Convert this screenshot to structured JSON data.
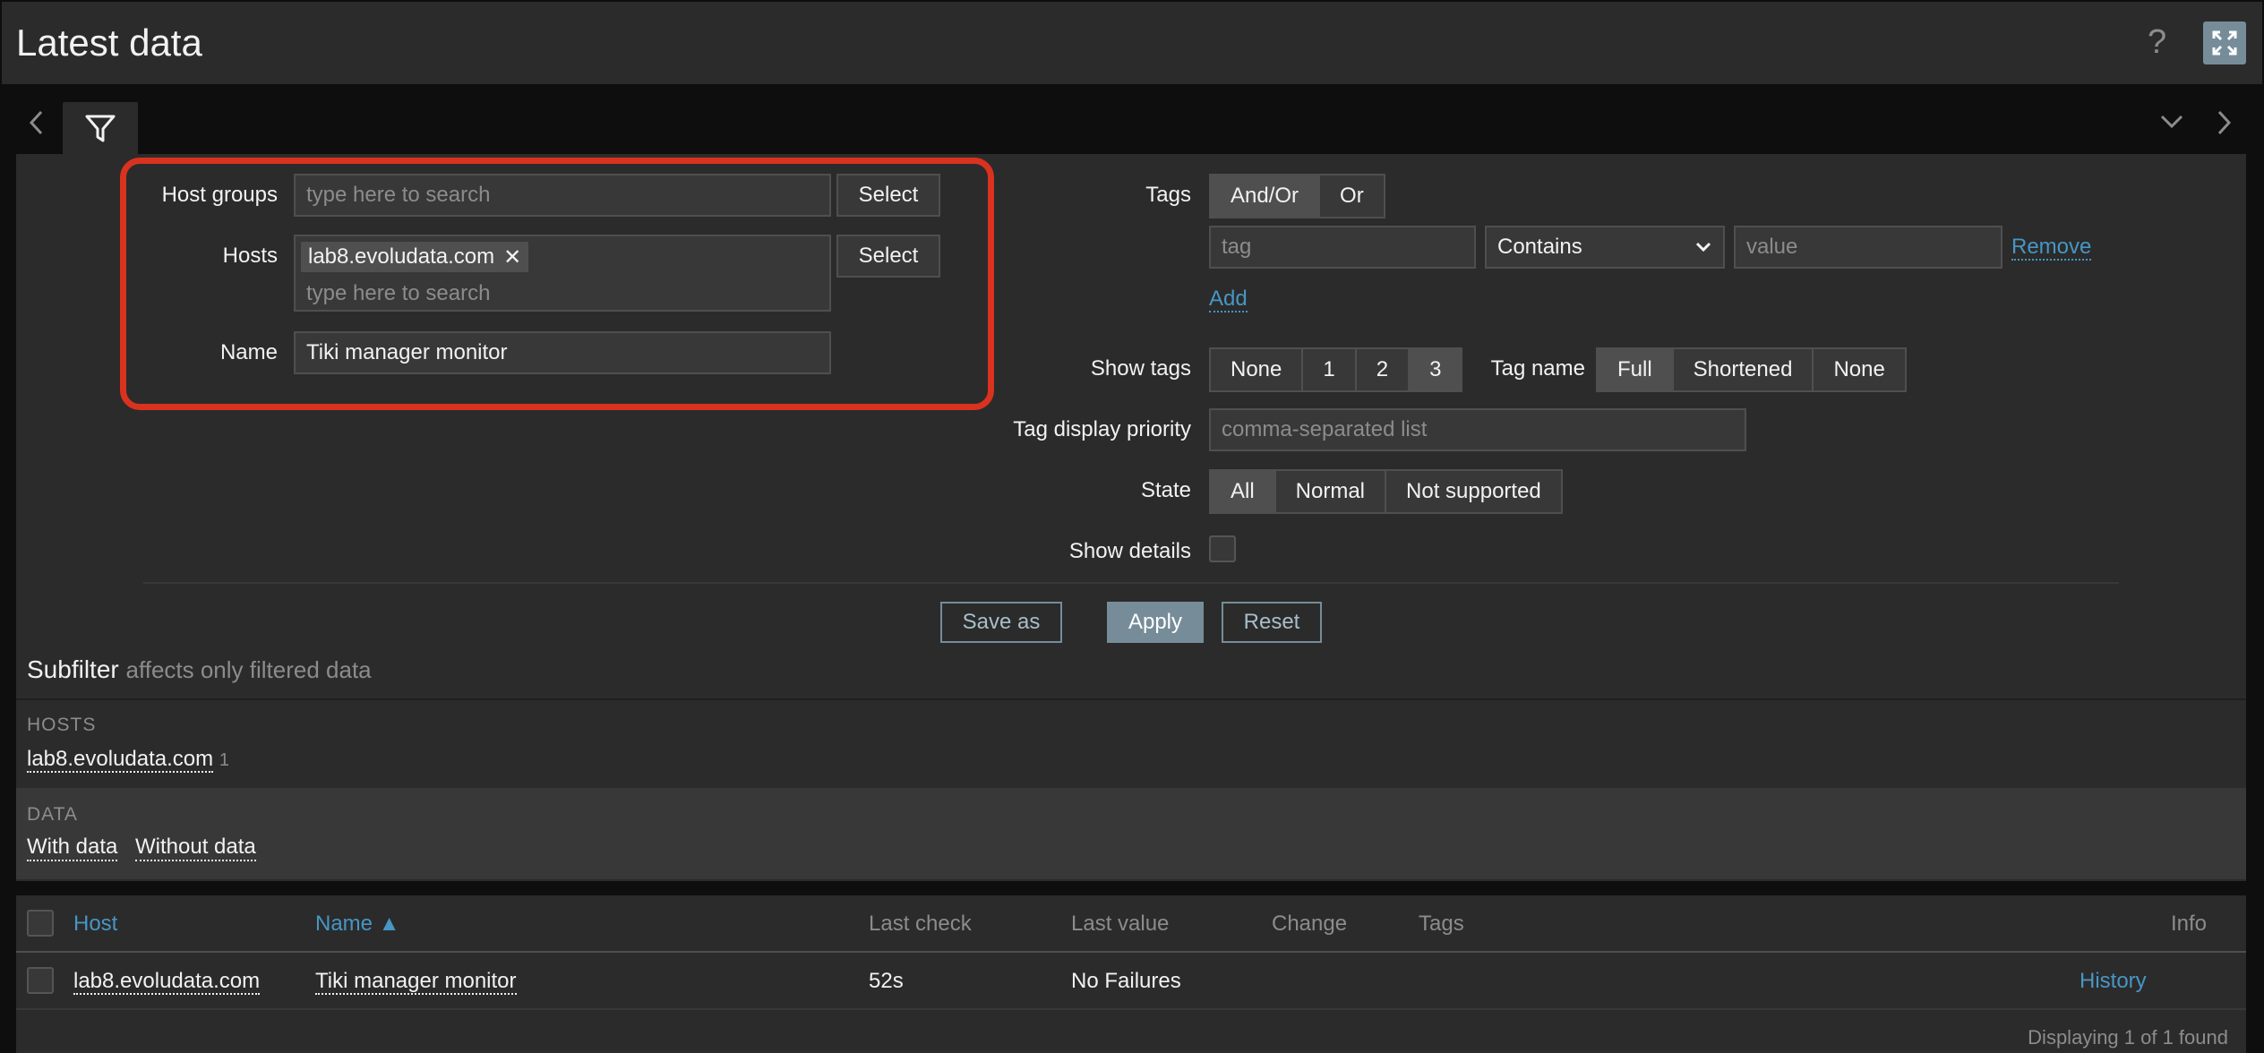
{
  "header": {
    "title": "Latest data",
    "help": "?"
  },
  "filter": {
    "host_groups": {
      "label": "Host groups",
      "placeholder": "type here to search",
      "select": "Select"
    },
    "hosts": {
      "label": "Hosts",
      "chip": "lab8.evoludata.com",
      "chip_remove": "✕",
      "placeholder": "type here to search",
      "select": "Select"
    },
    "name": {
      "label": "Name",
      "value": "Tiki manager monitor"
    },
    "tags": {
      "label": "Tags",
      "operators": [
        "And/Or",
        "Or"
      ],
      "tag_placeholder": "tag",
      "condition": "Contains",
      "value_placeholder": "value",
      "remove": "Remove",
      "add": "Add"
    },
    "show_tags": {
      "label": "Show tags",
      "options": [
        "None",
        "1",
        "2",
        "3"
      ]
    },
    "tag_name": {
      "label": "Tag name",
      "options": [
        "Full",
        "Shortened",
        "None"
      ]
    },
    "tag_priority": {
      "label": "Tag display priority",
      "placeholder": "comma-separated list"
    },
    "state": {
      "label": "State",
      "options": [
        "All",
        "Normal",
        "Not supported"
      ]
    },
    "show_details": {
      "label": "Show details"
    },
    "buttons": {
      "save_as": "Save as",
      "apply": "Apply",
      "reset": "Reset"
    }
  },
  "subfilter": {
    "title": "Subfilter",
    "note": "affects only filtered data",
    "hosts_heading": "HOSTS",
    "host_link": "lab8.evoludata.com",
    "host_count": "1",
    "data_heading": "DATA",
    "with_data": "With data",
    "without_data": "Without data"
  },
  "table": {
    "columns": [
      "Host",
      "Name ▲",
      "Last check",
      "Last value",
      "Change",
      "Tags",
      "Info"
    ],
    "rows": [
      {
        "host": "lab8.evoludata.com",
        "name": "Tiki manager monitor",
        "last_check": "52s",
        "last_value": "No Failures",
        "change": "",
        "tags": "",
        "history": "History"
      }
    ],
    "footer": "Displaying 1 of 1 found"
  },
  "colors": {
    "accent": "#4796c4",
    "highlight": "#d9321f",
    "button": "#768d99"
  }
}
